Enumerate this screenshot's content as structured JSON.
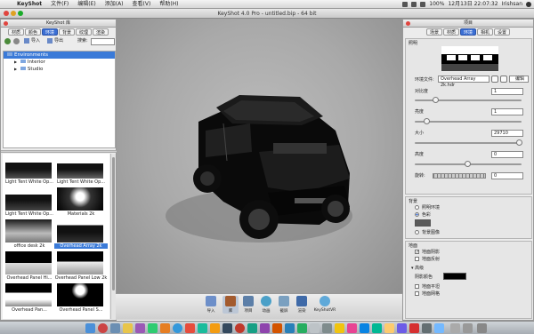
{
  "menubar": {
    "apple": "",
    "app": "KeyShot",
    "items": [
      "文件(F)",
      "编辑(E)",
      "添加(A)",
      "查看(V)",
      "帮助(H)"
    ],
    "datetime": "12月13日 22:07:32",
    "user": "Irishsan",
    "battery": "100%"
  },
  "window": {
    "title": "KeyShot 4.0 Pro  -  untitled.bip  -  64 bit"
  },
  "library": {
    "title": "KeyShot 库",
    "tabs": [
      "材质",
      "颜色",
      "环境",
      "背景",
      "纹理",
      "渲染"
    ],
    "selected_tab": 2,
    "actions": [
      "导入",
      "导出"
    ],
    "search_label": "搜索:",
    "search_value": "",
    "tree": [
      "Environments",
      "Interior",
      "Studio"
    ],
    "thumbnails": [
      "Light Tent White Op...",
      "Light Tent White Op...",
      "Light Tent White Op...",
      "Materials 2k",
      "office desk 2k",
      "Overhead Array 2k",
      "Overhead Panel Hi...",
      "Overhead Panel Low 2k",
      "Overhead Pan...",
      "Overhead Panel S..."
    ],
    "selected_thumb": 5
  },
  "project": {
    "title": "项目",
    "tabs": [
      "场景",
      "材质",
      "环境",
      "相机",
      "设置"
    ],
    "selected_tab": 2,
    "preview_label": "照明",
    "env_label": "环境文件:",
    "env_value": "Overhead Array 2k.hdr",
    "edit_label": "编辑",
    "contrast_label": "对比度",
    "contrast_value": "1",
    "contrast_level": 0.2,
    "brightness_label": "亮度",
    "brightness_value": "1",
    "brightness_level": 0.12,
    "size_label": "大小",
    "size_value": "29710",
    "size_level": 0.98,
    "height_label": "高度",
    "height_value": "0",
    "height_level": 0.5,
    "rotation_label": "旋转:",
    "rotation_value": "0",
    "rotation_level": 0.05,
    "background_label": "背景",
    "bg_options": [
      "照明环境",
      "色彩",
      "背景图像"
    ],
    "bg_selected": 1,
    "bg_color": "#5a5a5a",
    "ground_label": "地面",
    "ground_shadow": "地面阴影",
    "ground_reflection": "地面反射",
    "advanced": "高级",
    "shadow_color_label": "阴影颜色",
    "shadow_color": "#000000",
    "ground_flat": "地面平坦",
    "ground_grid": "地面网格",
    "ground_shadow_checked": true,
    "ground_reflection_checked": false
  },
  "toolbar": {
    "buttons": [
      "导入",
      "库",
      "项目",
      "动画",
      "截屏",
      "渲染",
      "KeyShotVR"
    ]
  },
  "colors": {
    "accent": "#3a7ad8",
    "viewport": "#a9a9a9"
  }
}
